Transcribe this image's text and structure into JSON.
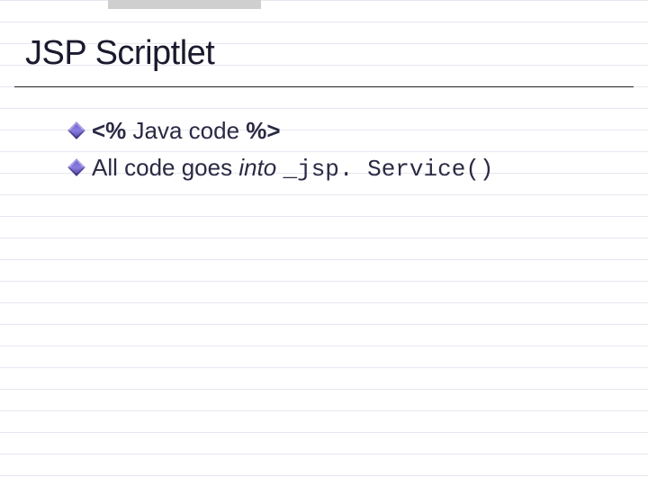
{
  "slide": {
    "title": "JSP Scriptlet",
    "bullets": {
      "b1": {
        "open": "<%",
        "mid": " Java code ",
        "close": "%>"
      },
      "b2": {
        "lead": "All code goes ",
        "italic": "into ",
        "mono": "_jsp. Service()"
      }
    }
  }
}
